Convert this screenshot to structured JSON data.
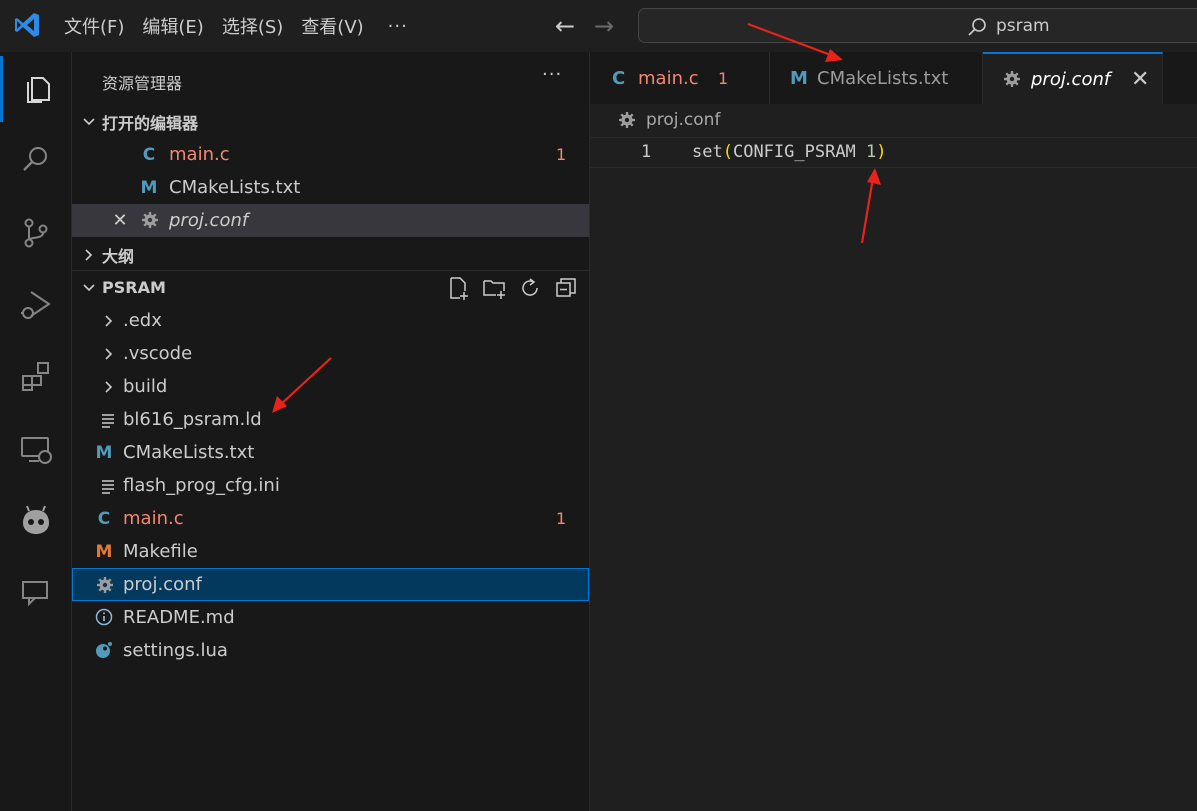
{
  "titlebar": {
    "menu": [
      "文件(F)",
      "编辑(E)",
      "选择(S)",
      "查看(V)"
    ],
    "more": "···",
    "search_value": "psram"
  },
  "activitybar": {
    "items": [
      "explorer-icon",
      "search-icon",
      "source-control-icon",
      "run-debug-icon",
      "extensions-icon",
      "remote-explorer-icon",
      "platformio-icon",
      "chat-icon"
    ]
  },
  "sidebar": {
    "title": "资源管理器",
    "more": "···",
    "open_editors": {
      "header": "打开的编辑器",
      "items": [
        {
          "icon": "C",
          "label": "main.c",
          "badge": "1"
        },
        {
          "icon": "M",
          "label": "CMakeLists.txt"
        },
        {
          "icon": "gear-icon",
          "label": "proj.conf",
          "close": "✕"
        }
      ]
    },
    "outline": {
      "header": "大纲"
    },
    "project": {
      "header": "PSRAM",
      "items": [
        {
          "label": ".edx",
          "type": "folder"
        },
        {
          "label": ".vscode",
          "type": "folder"
        },
        {
          "label": "build",
          "type": "folder"
        },
        {
          "label": "bl616_psram.ld",
          "type": "text-file"
        },
        {
          "label": "CMakeLists.txt",
          "type": "cmake",
          "icon": "M"
        },
        {
          "label": "flash_prog_cfg.ini",
          "type": "text-file"
        },
        {
          "label": "main.c",
          "type": "c",
          "icon": "C",
          "badge": "1"
        },
        {
          "label": "Makefile",
          "type": "makefile",
          "icon": "M"
        },
        {
          "label": "proj.conf",
          "type": "config"
        },
        {
          "label": "README.md",
          "type": "info"
        },
        {
          "label": "settings.lua",
          "type": "lua"
        }
      ]
    }
  },
  "editor": {
    "tabs": [
      {
        "icon": "C",
        "label": "main.c",
        "badge": "1"
      },
      {
        "icon": "M",
        "label": "CMakeLists.txt"
      },
      {
        "icon": "gear-icon",
        "label": "proj.conf",
        "close": "✕"
      }
    ],
    "breadcrumb": "proj.conf",
    "line_number": "1",
    "code": {
      "fn": "set",
      "open": "(",
      "arg": "CONFIG_PSRAM ",
      "num": "1",
      "close": ")"
    }
  },
  "colors": {
    "accent": "#0078d4",
    "error": "#f48771",
    "annotation_arrow": "#e8231a"
  }
}
